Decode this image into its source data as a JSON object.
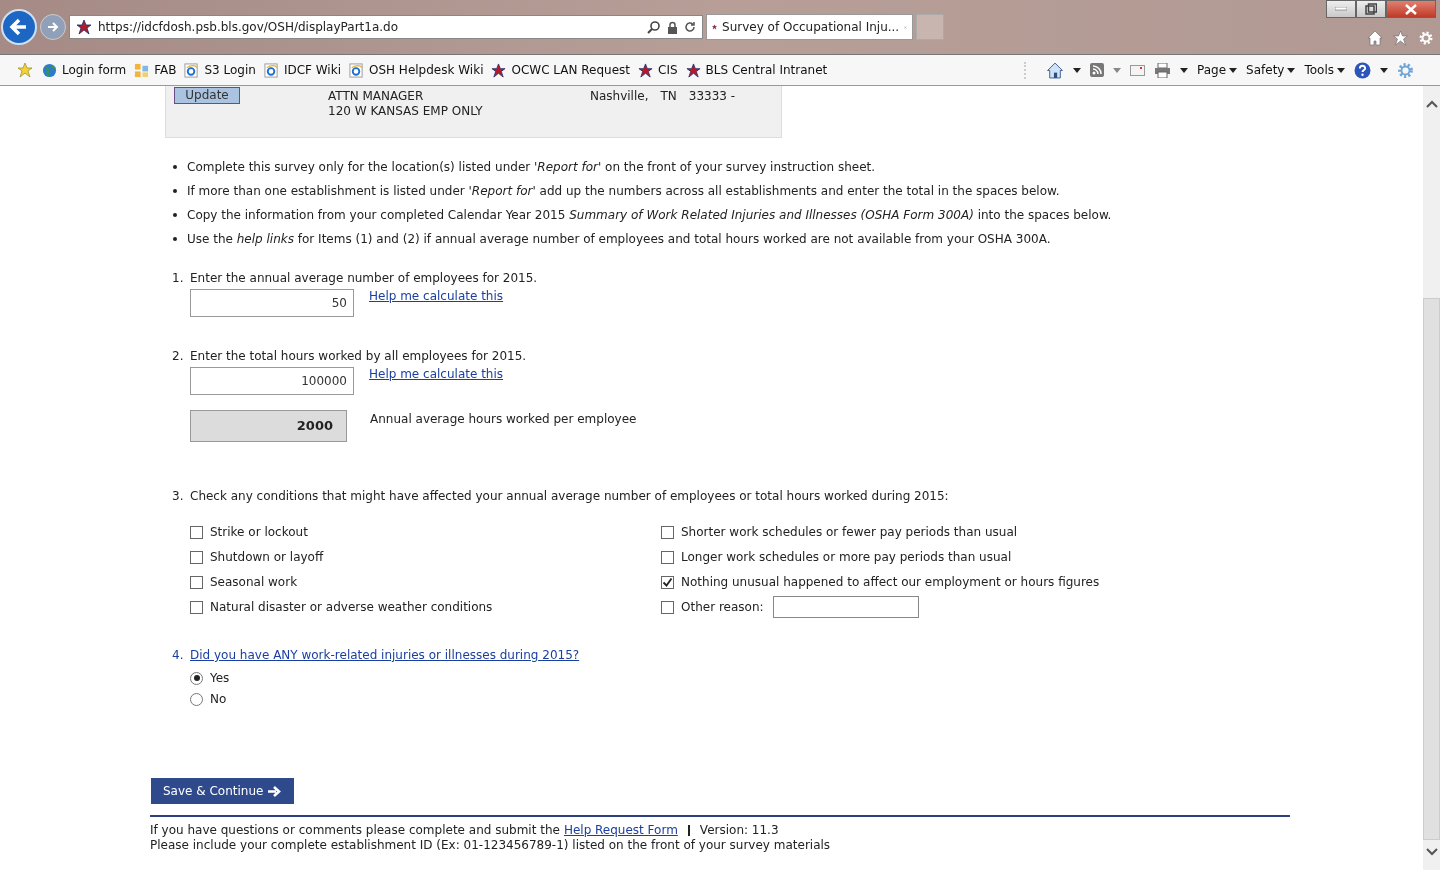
{
  "browser": {
    "address": "https://idcfdosh.psb.bls.gov/OSH/displayPart1a.do",
    "tab_title": "Survey of Occupational Inju...",
    "favorites": [
      {
        "label": "Login form",
        "kind": "globe"
      },
      {
        "label": "FAB",
        "kind": "tiles"
      },
      {
        "label": "S3 Login",
        "kind": "ie"
      },
      {
        "label": "IDCF Wiki",
        "kind": "ie"
      },
      {
        "label": "OSH Helpdesk Wiki",
        "kind": "ie"
      },
      {
        "label": "OCWC LAN Request",
        "kind": "star"
      },
      {
        "label": "CIS",
        "kind": "star"
      },
      {
        "label": "BLS Central Intranet",
        "kind": "star"
      }
    ],
    "menus": [
      "Page",
      "Safety",
      "Tools"
    ]
  },
  "address_box": {
    "button": "Update",
    "lines": [
      "ATTN MANAGER",
      "120 W KANSAS EMP ONLY"
    ],
    "city": "Nashville,",
    "state": "TN",
    "zip": "33333 -"
  },
  "instructions": [
    "Complete this survey only for the location(s) listed under *'Report for'* on the front of your survey instruction sheet.",
    "If more than one establishment is listed under *'Report for'* add up the numbers across all establishments and enter the total in the spaces below.",
    "Copy the information from your completed Calendar Year 2015 *Summary of Work Related Injuries and Illnesses (OSHA Form 300A)* into the spaces below.",
    "Use the *help links* for Items (1) and (2) if annual average number of employees and total hours worked are not available from your OSHA 300A."
  ],
  "q1": {
    "number": "1.",
    "text": "Enter the annual average number of employees for 2015.",
    "value": "50",
    "help": "Help me calculate this"
  },
  "q2": {
    "number": "2.",
    "text": "Enter the total hours worked by all employees for 2015.",
    "value": "100000",
    "help": "Help me calculate this",
    "computed": "2000",
    "computed_label": "Annual average hours worked per employee"
  },
  "q3": {
    "number": "3.",
    "text": "Check any conditions that might have affected your annual average number of employees or total hours worked during 2015:",
    "columns": [
      [
        {
          "label": "Strike or lockout",
          "checked": false,
          "kind": "check"
        },
        {
          "label": "Shutdown or layoff",
          "checked": false,
          "kind": "check"
        },
        {
          "label": "Seasonal work",
          "checked": false,
          "kind": "check"
        },
        {
          "label": "Natural disaster or adverse weather conditions",
          "checked": false,
          "kind": "check"
        }
      ],
      [
        {
          "label": "Shorter work schedules or fewer pay periods than usual",
          "checked": false,
          "kind": "check"
        },
        {
          "label": "Longer work schedules or more pay periods than usual",
          "checked": false,
          "kind": "check"
        },
        {
          "label": "Nothing unusual happened to affect our employment or hours figures",
          "checked": true,
          "kind": "check"
        },
        {
          "label": "Other reason:",
          "checked": false,
          "kind": "other"
        }
      ]
    ]
  },
  "q4": {
    "number": "4.",
    "text": "Did you have ANY work-related injuries or illnesses during 2015?",
    "options": [
      {
        "label": "Yes",
        "selected": true
      },
      {
        "label": "No",
        "selected": false
      }
    ]
  },
  "submit": "Save & Continue",
  "footer": {
    "text": "If you have questions or comments please complete and submit the",
    "link": "Help Request Form",
    "version": "Version: 11.3",
    "note": "Please include your complete establishment ID (Ex: 01-123456789-1) listed on the front of your survey materials"
  }
}
